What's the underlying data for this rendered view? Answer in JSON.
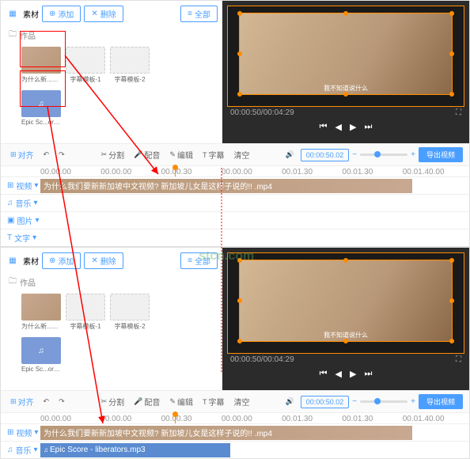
{
  "toolbar": {
    "material": "素材",
    "add": "添加",
    "delete": "删除",
    "all": "全部"
  },
  "folder": {
    "label": "作品"
  },
  "media": {
    "video1": "为什么新...mp4",
    "subtitle1": "字幕模板-1",
    "subtitle2": "字幕模板-2",
    "audio1": "Epic Sc...ors.mp3"
  },
  "preview": {
    "subtitle": "我不知道说什么",
    "time_current": "00:00:50/00:04:29"
  },
  "tools": {
    "align": "对齐",
    "undo": "",
    "redo": "",
    "split": "分割",
    "record": "配音",
    "edit": "编辑",
    "caption": "字幕",
    "clear": "清空",
    "timebox": "00:00:50.02",
    "export": "导出视频"
  },
  "ruler": [
    "00.00.00",
    "00.00.00",
    "00.00.30",
    "00.00.00",
    "00.01.30",
    "00.01.30",
    "00.01.40.00"
  ],
  "tracks": {
    "video": "视频",
    "audio": "音乐",
    "image": "图片",
    "text": "文字",
    "video_clip": "为什么我们要新新加坡中文视频? 新加坡儿女是这样子说的!!  .mp4",
    "audio_clip": "Epic Score - liberators.mp3"
  },
  "watermark": "stcn.com"
}
